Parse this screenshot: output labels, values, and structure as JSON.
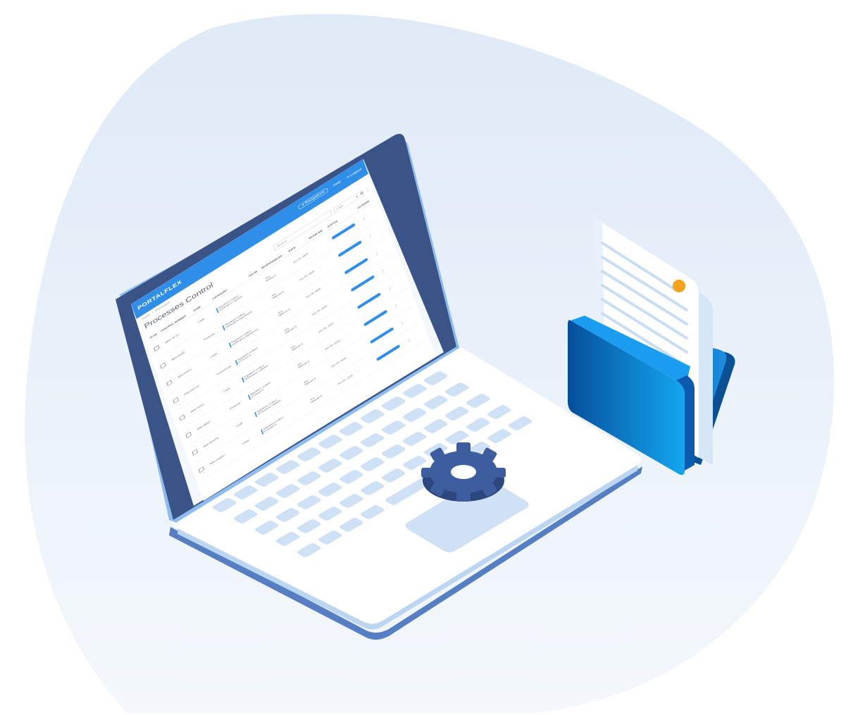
{
  "app": {
    "brand": "PORTALFLEX",
    "user_menu": "Ravigaduns",
    "help_link": "Help",
    "logout_link": "Logout"
  },
  "breadcrumb": [
    "Home",
    "Processes"
  ],
  "page_title": "Processes Control",
  "toolbar": {
    "search_placeholder": "Search",
    "filter_placeholder": "Filter"
  },
  "table": {
    "headers": [
      "FLAG",
      "CONTROL NUMBER",
      "ZONE",
      "CATEGORY",
      "VALUE",
      "RESPONSIBLES",
      "DATE",
      "DEADLINE",
      "STATUS",
      "ACTIONS"
    ],
    "rows": [
      {
        "control": "BRA-7G-FY",
        "zone": "Legal",
        "cat1": "Signature Collect",
        "cat2": "Verification Labeled",
        "value": "",
        "resp1": "Avy",
        "resp2": "Dulies S",
        "date": "Jun 23, 2020",
        "deadline": "-"
      },
      {
        "control": "BRA-8G4D",
        "zone": "Financial",
        "cat1": "Signature Collect",
        "cat2": "Verification Agreement",
        "value": "",
        "resp1": "Avy",
        "resp2": "Manuel S",
        "date": "Jun 25, 2020",
        "deadline": "-"
      },
      {
        "control": "BRA-9YE1L",
        "zone": "Legal",
        "cat1": "Signature Collect",
        "cat2": "Verification Agreement",
        "value": "",
        "resp1": "Avy",
        "resp2": "Manuel S",
        "date": "Jun 25, 2020",
        "deadline": "-"
      },
      {
        "control": "PRA-A8TYU",
        "zone": "Commercial",
        "cat1": "Signature Collect",
        "cat2": "Contract S",
        "value": "",
        "resp1": "Avy",
        "resp2": "Manuel S",
        "date": "Jun 25, 2020",
        "deadline": "-"
      },
      {
        "control": "BRA-NJPG",
        "zone": "Legal",
        "cat1": "Signature Collect",
        "cat2": "Verification Labeled",
        "value": "",
        "resp1": "Avy",
        "resp2": "Manuel S",
        "date": "Jun 25, 2020",
        "deadline": "-"
      },
      {
        "control": "BRA-8RSX",
        "zone": "Financial",
        "cat1": "Signature Collect",
        "cat2": "Contract S",
        "value": "",
        "resp1": "Avy",
        "resp2": "Manuel S",
        "date": "Jun 25, 2020",
        "deadline": "-"
      },
      {
        "control": "BRA-M2AYB",
        "zone": "Legal",
        "cat1": "Signature Collect",
        "cat2": "Verification Labeled",
        "value": "",
        "resp1": "Avy",
        "resp2": "Manuel S",
        "date": "Jun 25, 2020",
        "deadline": "-"
      },
      {
        "control": "BRA-ASBDY",
        "zone": "Legal",
        "cat1": "Signature Collect",
        "cat2": "Contract S",
        "value": "",
        "resp1": "Avy",
        "resp2": "Manuel S",
        "date": "Jun 25, 2020",
        "deadline": "-"
      }
    ]
  },
  "colors": {
    "accent": "#2f8fe8",
    "laptop_bezel": "#3a5487",
    "keyboard_key": "#cfe1f5",
    "folder_blue": "#0a78d4",
    "gear": "#3d5d9e",
    "background_blob": "#e3edf8",
    "document_dot": "#f5a21b"
  },
  "icons": [
    "gear-icon",
    "folder-icon",
    "document-icon",
    "user-icon",
    "logout-icon",
    "more-vert-icon",
    "checkbox-icon"
  ]
}
